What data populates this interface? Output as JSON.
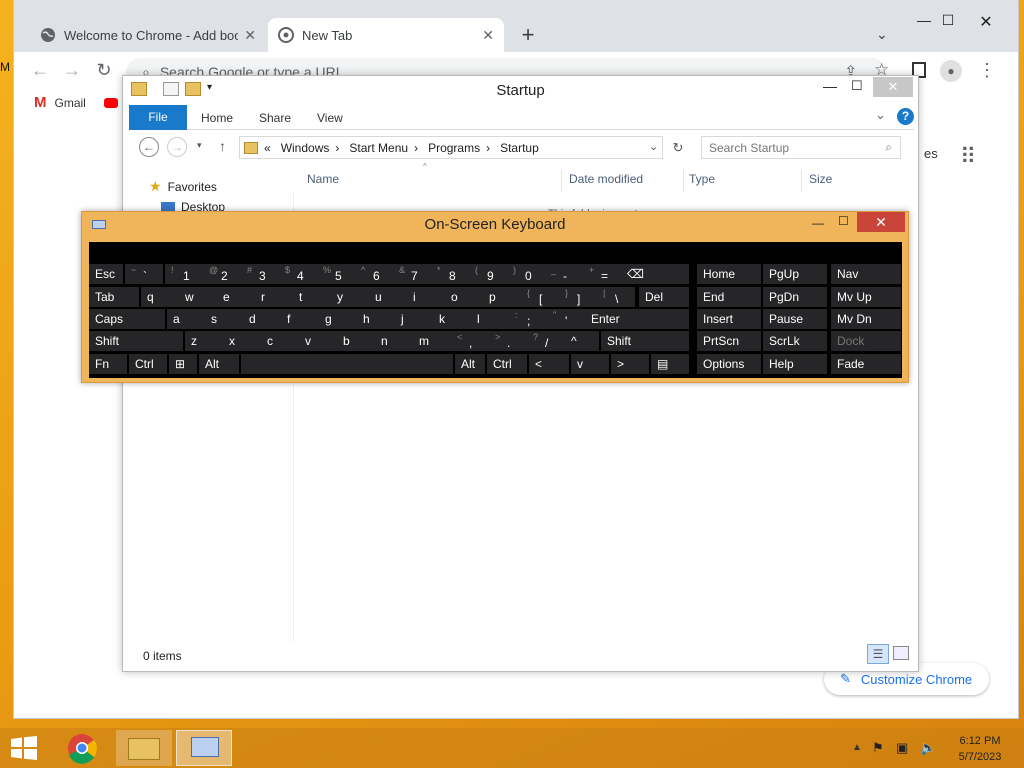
{
  "desktop": {
    "partial_icon_label": "M"
  },
  "chrome": {
    "tabs": [
      {
        "title": "Welcome to Chrome - Add book",
        "close": "✕"
      },
      {
        "title": "New Tab",
        "close": "✕"
      }
    ],
    "new_tab": "+",
    "window_controls": {
      "minimize": "—",
      "maximize": "☐",
      "close": "✕"
    },
    "omnibox_placeholder": "Search Google or type a URL",
    "bookmarks": [
      {
        "label": "Gmail"
      }
    ],
    "shortcuts_partial": "es",
    "customize_label": "Customize Chrome"
  },
  "explorer": {
    "title": "Startup",
    "ribbon_tabs": [
      "File",
      "Home",
      "Share",
      "View"
    ],
    "help": "?",
    "breadcrumb": [
      "Windows",
      "Start Menu",
      "Programs",
      "Startup"
    ],
    "breadcrumb_prefix": "«",
    "search_placeholder": "Search Startup",
    "columns": [
      "Name",
      "Date modified",
      "Type",
      "Size"
    ],
    "nav": [
      {
        "label": "Favorites"
      },
      {
        "label": "Desktop"
      }
    ],
    "empty_partial": "This folder is empty.",
    "status": "0 items"
  },
  "osk": {
    "title": "On-Screen Keyboard",
    "close": "✕",
    "rows": [
      [
        [
          "Esc",
          ""
        ],
        [
          "`",
          "~"
        ],
        [
          "1",
          "!"
        ],
        [
          "2",
          "@"
        ],
        [
          "3",
          "#"
        ],
        [
          "4",
          "$"
        ],
        [
          "5",
          "%"
        ],
        [
          "6",
          "^"
        ],
        [
          "7",
          "&"
        ],
        [
          "8",
          "*"
        ],
        [
          "9",
          "("
        ],
        [
          "0",
          ")"
        ],
        [
          "-",
          "_"
        ],
        [
          "=",
          "+"
        ],
        [
          "⌫",
          ""
        ]
      ],
      [
        [
          "Tab",
          ""
        ],
        [
          "q",
          ""
        ],
        [
          "w",
          ""
        ],
        [
          "e",
          ""
        ],
        [
          "r",
          ""
        ],
        [
          "t",
          ""
        ],
        [
          "y",
          ""
        ],
        [
          "u",
          ""
        ],
        [
          "i",
          ""
        ],
        [
          "o",
          ""
        ],
        [
          "p",
          ""
        ],
        [
          "[",
          "{"
        ],
        [
          "]",
          "}"
        ],
        [
          "\\",
          "|"
        ],
        [
          "Del",
          ""
        ]
      ],
      [
        [
          "Caps",
          ""
        ],
        [
          "a",
          ""
        ],
        [
          "s",
          ""
        ],
        [
          "d",
          ""
        ],
        [
          "f",
          ""
        ],
        [
          "g",
          ""
        ],
        [
          "h",
          ""
        ],
        [
          "j",
          ""
        ],
        [
          "k",
          ""
        ],
        [
          "l",
          ""
        ],
        [
          ";",
          ":"
        ],
        [
          "'",
          "\""
        ],
        [
          "Enter",
          ""
        ]
      ],
      [
        [
          "Shift",
          ""
        ],
        [
          "z",
          ""
        ],
        [
          "x",
          ""
        ],
        [
          "c",
          ""
        ],
        [
          "v",
          ""
        ],
        [
          "b",
          ""
        ],
        [
          "n",
          ""
        ],
        [
          "m",
          ""
        ],
        [
          ",",
          "<"
        ],
        [
          ".",
          ">"
        ],
        [
          "/",
          "?"
        ],
        [
          "^",
          ""
        ],
        [
          "Shift",
          ""
        ]
      ],
      [
        [
          "Fn",
          ""
        ],
        [
          "Ctrl",
          ""
        ],
        [
          "⊞",
          ""
        ],
        [
          "Alt",
          ""
        ],
        [
          "",
          ""
        ],
        [
          "Alt",
          ""
        ],
        [
          "Ctrl",
          ""
        ],
        [
          "<",
          ""
        ],
        [
          "v",
          ""
        ],
        [
          ">",
          ""
        ],
        [
          "▤",
          ""
        ]
      ]
    ],
    "nav_keys": [
      [
        "Home",
        "PgUp",
        "Nav"
      ],
      [
        "End",
        "PgDn",
        "Mv Up"
      ],
      [
        "Insert",
        "Pause",
        "Mv Dn"
      ],
      [
        "PrtScn",
        "ScrLk",
        "Dock"
      ],
      [
        "Options",
        "Help",
        "Fade"
      ]
    ]
  },
  "taskbar": {
    "time": "6:12 PM",
    "date": "5/7/2023"
  }
}
